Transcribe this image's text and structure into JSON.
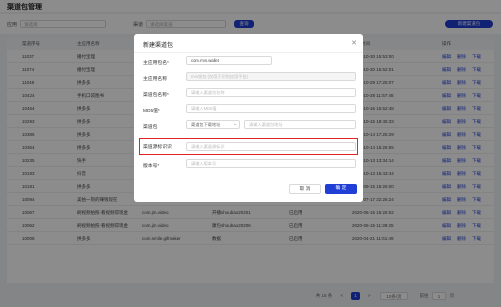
{
  "page": {
    "title": "渠道包管理"
  },
  "filter": {
    "app_label": "应用",
    "app_placeholder": "请选择",
    "channel_label": "渠道",
    "channel_placeholder": "请选择渠道",
    "search_button": "查询",
    "create_button": "新建渠道包"
  },
  "table": {
    "headers": [
      "渠道序号",
      "主应用名称",
      "渠道包名",
      "渠道名称",
      "状态",
      "创建时间",
      "操作"
    ],
    "rows": [
      {
        "id": "11037",
        "app": "播付宝理",
        "pkg": "",
        "channel": "",
        "status": "",
        "time": "2020-10-30 15:53:00",
        "ops": [
          "编辑",
          "删除",
          "下载"
        ]
      },
      {
        "id": "11074",
        "app": "播付宝理",
        "pkg": "",
        "channel": "",
        "status": "",
        "time": "2020-10-30 15:52:01",
        "ops": [
          "编辑",
          "删除",
          "下载"
        ]
      },
      {
        "id": "11048",
        "app": "拼多多",
        "pkg": "",
        "channel": "",
        "status": "",
        "time": "2020-10-29 17:25:07",
        "ops": [
          "编辑",
          "删除",
          "下载"
        ]
      },
      {
        "id": "10424",
        "app": "手机口袋图书",
        "pkg": "",
        "channel": "",
        "status": "",
        "time": "2020-10-28 11:57:48",
        "ops": [
          "编辑",
          "删除",
          "下载"
        ]
      },
      {
        "id": "10464",
        "app": "拼多多",
        "pkg": "",
        "channel": "",
        "status": "",
        "time": "2020-10-16 15:52:48",
        "ops": [
          "编辑",
          "删除",
          "下载"
        ]
      },
      {
        "id": "10293",
        "app": "拼多多",
        "pkg": "",
        "channel": "",
        "status": "",
        "time": "2020-10-15 18:45:33",
        "ops": [
          "编辑",
          "删除",
          "下载"
        ]
      },
      {
        "id": "10385",
        "app": "拼多多",
        "pkg": "",
        "channel": "",
        "status": "",
        "time": "2020-10-14 17:25:29",
        "ops": [
          "编辑",
          "删除",
          "下载"
        ]
      },
      {
        "id": "10364",
        "app": "拼多多",
        "pkg": "",
        "channel": "",
        "status": "",
        "time": "2020-10-14 15:26:55",
        "ops": [
          "编辑",
          "删除",
          "下载"
        ]
      },
      {
        "id": "10235",
        "app": "快手",
        "pkg": "",
        "channel": "",
        "status": "",
        "time": "2020-10-13 13:34:14",
        "ops": [
          "编辑",
          "删除",
          "下载"
        ]
      },
      {
        "id": "10193",
        "app": "抖音",
        "pkg": "com.ss.android.ugc.aweme",
        "channel": "抖音下载1713.2.6",
        "status": "已启用",
        "time": "2020-10-13 15:43:44",
        "ops": [
          "编辑",
          "删除",
          "下载"
        ]
      },
      {
        "id": "10181",
        "app": "拼多多",
        "pkg": "com.xunmeng.pinduoduo",
        "channel": "拼多多渠道包",
        "status": "已启用",
        "time": "2020-09-15 15:26:00",
        "ops": [
          "编辑",
          "删除",
          "下载"
        ]
      },
      {
        "id": "10094",
        "app": "美拍一刻的赚钱现在",
        "pkg": "com.jingdong.app.mall",
        "channel": "美拍渠道包0717",
        "status": "已启用",
        "time": "2020-07-17 22:26:24",
        "ops": [
          "编辑",
          "删除",
          "下载"
        ]
      },
      {
        "id": "10067",
        "app": "刷视频拍照-看视频得现金",
        "pkg": "com.jm.video",
        "channel": "开播shoubao20201",
        "status": "已启用",
        "time": "2020-06-15 15:26:52",
        "ops": [
          "编辑",
          "删除",
          "下载"
        ]
      },
      {
        "id": "10062",
        "app": "刷视频拍照-看视频得现金",
        "pkg": "com.jm.video",
        "channel": "康包shoubao20206",
        "status": "已启用",
        "time": "2020-06-15 11:39:25",
        "ops": [
          "编辑",
          "删除",
          "下载"
        ]
      },
      {
        "id": "10008",
        "app": "拼多多",
        "pkg": "com.smile.gifmaker",
        "channel": "数据",
        "status": "已启用",
        "time": "2020-04-21 11:51:49",
        "ops": [
          "编辑",
          "删除",
          "下载"
        ]
      }
    ]
  },
  "pagination": {
    "total": "共 15 条",
    "prev": "<",
    "current": "1",
    "next": ">",
    "page_size": "10条/页",
    "goto_label": "前往",
    "goto_value": "1",
    "page_suffix": "页"
  },
  "modal": {
    "title": "新建渠道包",
    "close_icon": "close-icon",
    "fields": {
      "main_app": {
        "label": "主应用包名*",
        "value": "com.rrvs.wallet"
      },
      "main_app_name": {
        "label": "主应用名称",
        "placeholder": "rrvs钱包 (仅用于识别应用平台)"
      },
      "channel_pkg": {
        "label": "渠道包名称*",
        "placeholder": "请输入渠道包名称"
      },
      "md5": {
        "label": "MD5值*",
        "placeholder": "请输入MD5值"
      },
      "channel": {
        "label": "渠道包",
        "select_placeholder": "渠道包下载地址",
        "input_placeholder": "请输入渠道包地址"
      },
      "channel_id": {
        "label": "渠道源标识识",
        "placeholder": "请输入渠道源标识"
      },
      "version": {
        "label": "版本号*",
        "placeholder": "请输入版本号"
      }
    },
    "cancel": "取 消",
    "confirm": "确 定"
  },
  "colors": {
    "primary": "#1f3fd6",
    "highlight": "#e02424"
  }
}
